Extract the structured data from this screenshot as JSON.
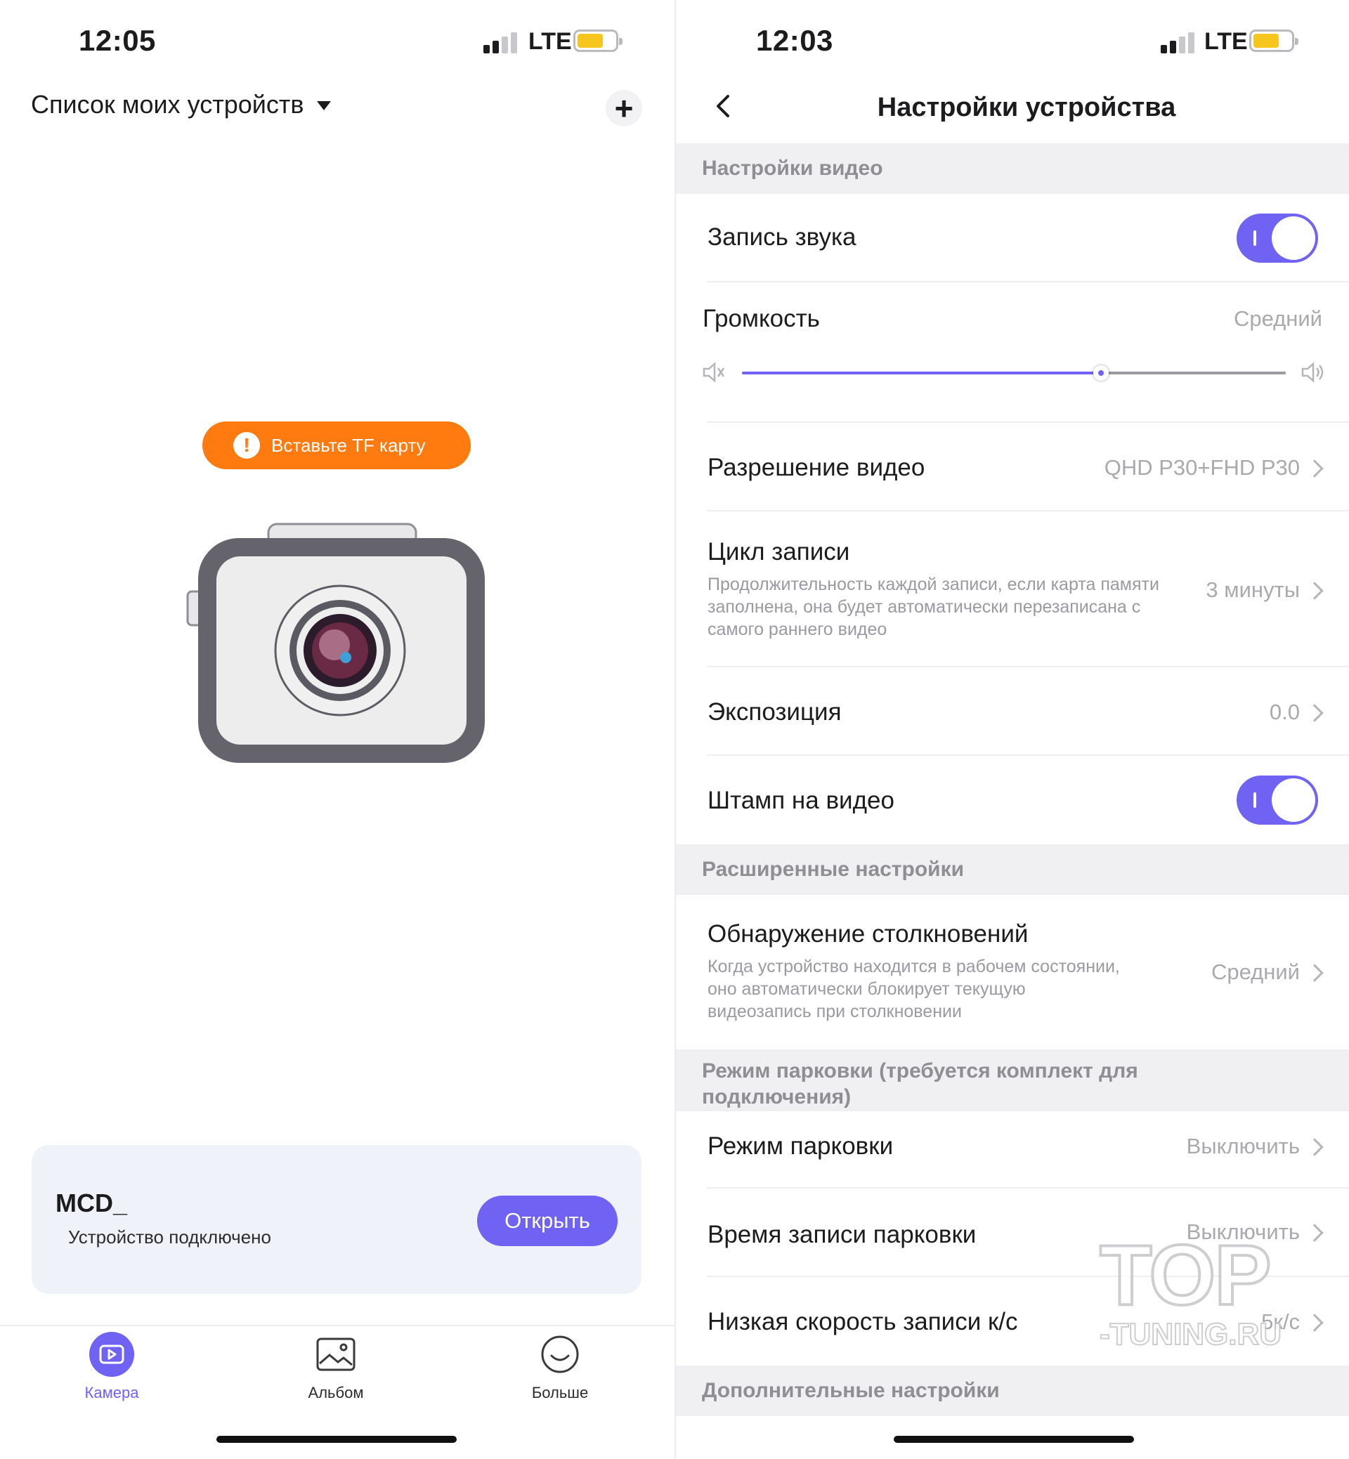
{
  "left": {
    "status": {
      "time": "12:05",
      "network": "LTE"
    },
    "header": {
      "title": "Список моих устройств",
      "add_icon": "plus-icon"
    },
    "alert": {
      "text": "Вставьте TF карту",
      "icon": "warning-icon"
    },
    "device": {
      "name": "MCD_",
      "status": "Устройство подключено",
      "open_label": "Открыть"
    },
    "tabs": [
      {
        "label": "Камера",
        "icon": "camera-tab-icon",
        "active": true
      },
      {
        "label": "Альбом",
        "icon": "album-icon",
        "active": false
      },
      {
        "label": "Больше",
        "icon": "more-smile-icon",
        "active": false
      }
    ]
  },
  "right": {
    "status": {
      "time": "12:03",
      "network": "LTE"
    },
    "nav": {
      "title": "Настройки устройства",
      "back_icon": "chevron-left-icon"
    },
    "sections": {
      "video": "Настройки видео",
      "advanced": "Расширенные настройки",
      "parking": "Режим парковки (требуется комплект для подключения)",
      "extra": "Дополнительные настройки"
    },
    "rows": {
      "audio_recording": {
        "label": "Запись звука",
        "enabled": true
      },
      "volume": {
        "label": "Громкость",
        "value": "Средний",
        "level_fraction": 0.66
      },
      "resolution": {
        "label": "Разрешение видео",
        "value": "QHD P30+FHD P30"
      },
      "loop": {
        "label": "Цикл записи",
        "desc": "Продолжительность каждой записи, если карта памяти заполнена, она будет автоматически перезаписана с самого раннего видео",
        "value": "3 минуты"
      },
      "exposure": {
        "label": "Экспозиция",
        "value": "0.0"
      },
      "stamp": {
        "label": "Штамп на видео",
        "enabled": true
      },
      "collision": {
        "label": "Обнаружение столкновений",
        "desc": "Когда устройство находится в рабочем состоянии, оно автоматически блокирует текущую видеозапись при столкновении",
        "value": "Средний"
      },
      "parking_mode": {
        "label": "Режим парковки",
        "value": "Выключить"
      },
      "parking_time": {
        "label": "Время записи парковки",
        "value": "Выключить"
      },
      "low_fps": {
        "label": "Низкая скорость записи к/с",
        "value": "5к/с"
      }
    },
    "watermark": {
      "line1": "TOP",
      "line2": "-TUNING.RU"
    }
  },
  "colors": {
    "accent": "#7062f2",
    "alert": "#ff7a0f",
    "section_bg": "#f0f0f3",
    "battery": "#f6c51e"
  }
}
